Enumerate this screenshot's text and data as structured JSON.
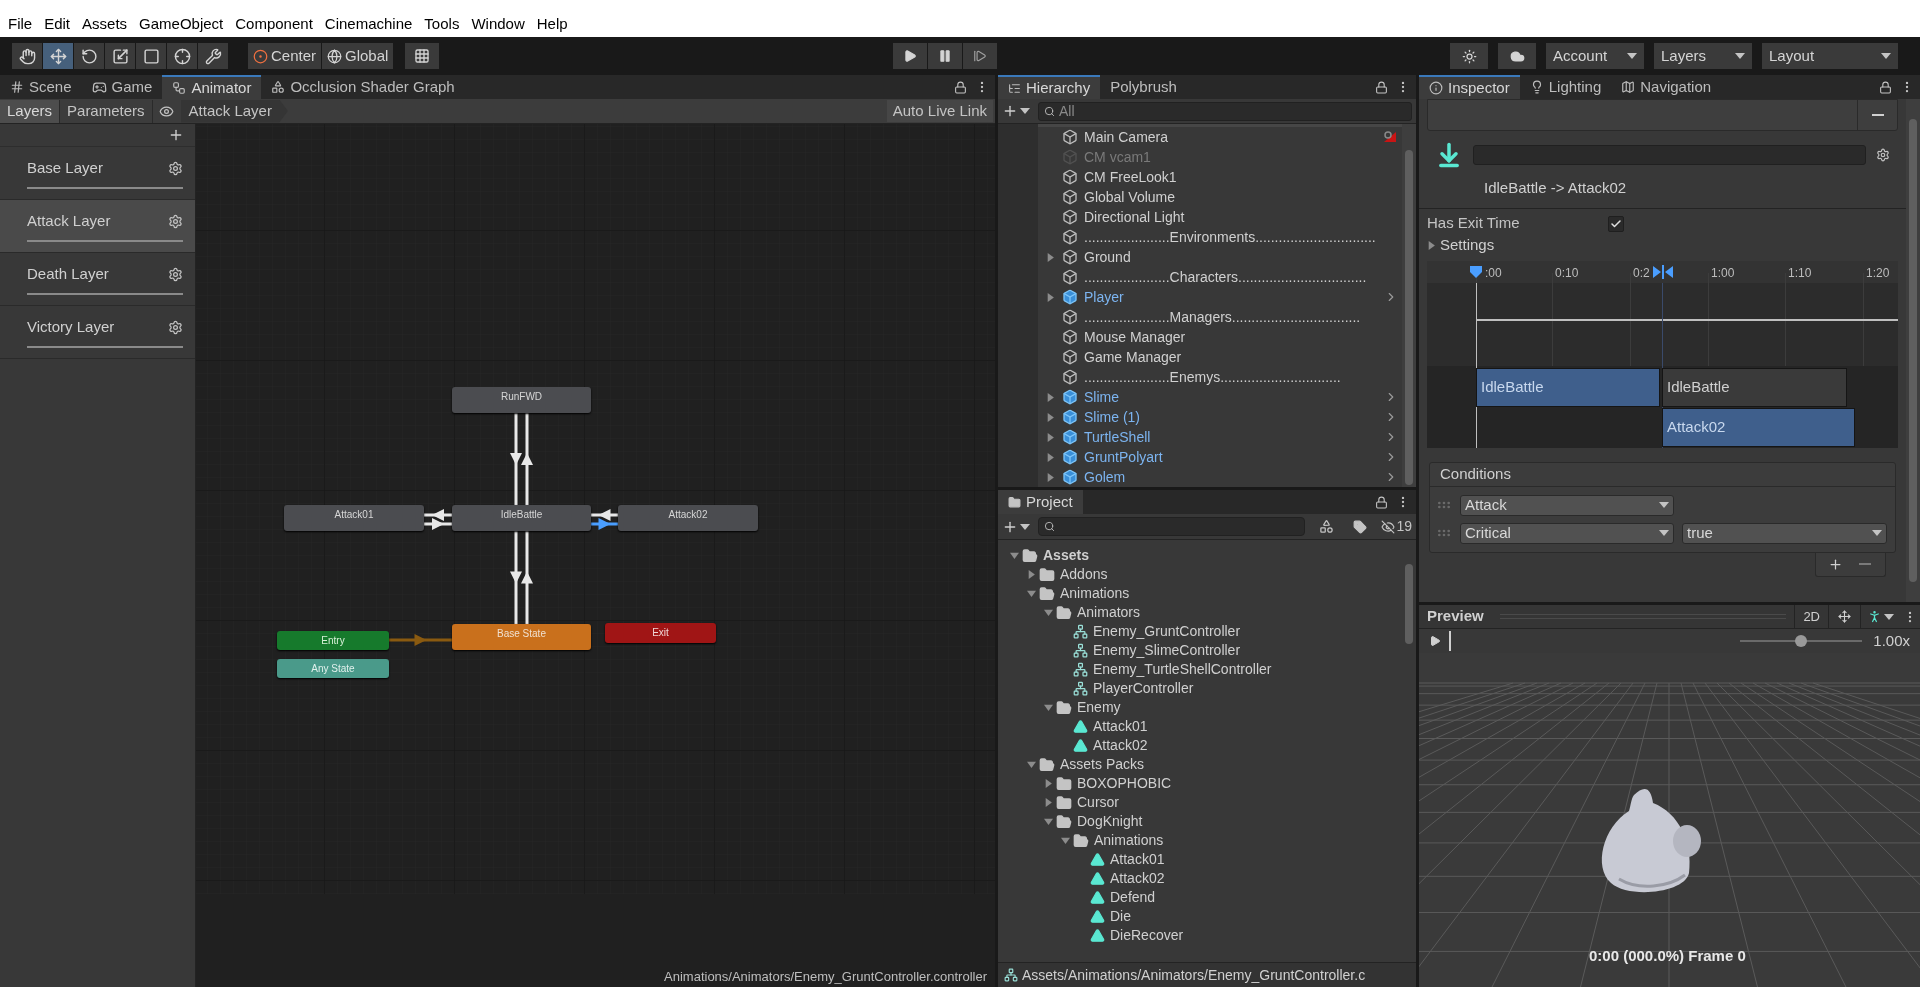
{
  "menu": [
    "File",
    "Edit",
    "Assets",
    "GameObject",
    "Component",
    "Cinemachine",
    "Tools",
    "Window",
    "Help"
  ],
  "toolbar": {
    "tools": [
      {
        "selected": false
      },
      {
        "selected": true
      },
      {
        "selected": false
      },
      {
        "selected": false
      },
      {
        "selected": false
      },
      {
        "selected": false
      },
      {
        "selected": false
      }
    ],
    "pivot": "Center",
    "space": "Global",
    "dropdowns": [
      "Account",
      "Layers",
      "Layout"
    ]
  },
  "animator": {
    "tabs": [
      {
        "label": "Scene",
        "selected": false
      },
      {
        "label": "Game",
        "selected": false
      },
      {
        "label": "Animator",
        "selected": true
      },
      {
        "label": "Occlusion Shader Graph",
        "selected": false
      }
    ],
    "side_tabs": [
      {
        "label": "Layers",
        "selected": true
      },
      {
        "label": "Parameters",
        "selected": false
      }
    ],
    "breadcrumb": "Attack Layer",
    "live_link": "Auto Live Link",
    "layers": [
      {
        "name": "Base Layer",
        "selected": false
      },
      {
        "name": "Attack Layer",
        "selected": true
      },
      {
        "name": "Death Layer",
        "selected": false
      },
      {
        "name": "Victory Layer",
        "selected": false
      }
    ],
    "nodes": [
      {
        "label": "RunFWD",
        "kind": "state"
      },
      {
        "label": "Attack01",
        "kind": "state"
      },
      {
        "label": "IdleBattle",
        "kind": "state"
      },
      {
        "label": "Attack02",
        "kind": "state"
      },
      {
        "label": "Base State",
        "kind": "default"
      },
      {
        "label": "Entry",
        "kind": "entry"
      },
      {
        "label": "Any State",
        "kind": "any"
      },
      {
        "label": "Exit",
        "kind": "exit"
      }
    ],
    "transitions": [
      {
        "kind": "normal",
        "selected": false
      },
      {
        "kind": "normal",
        "selected": false
      },
      {
        "kind": "normal",
        "selected": false
      },
      {
        "kind": "normal",
        "selected": false
      },
      {
        "kind": "normal",
        "selected": false
      },
      {
        "kind": "normal",
        "selected": true
      },
      {
        "kind": "normal",
        "selected": false
      },
      {
        "kind": "normal",
        "selected": false
      },
      {
        "kind": "entry",
        "selected": false
      }
    ],
    "path": "Animations/Animators/Enemy_GruntController.controller"
  },
  "hierarchy": {
    "tabs": [
      {
        "label": "Hierarchy",
        "selected": true
      },
      {
        "label": "Polybrush",
        "selected": false
      }
    ],
    "search": {
      "placeholder": "All"
    },
    "items": [
      {
        "name": "Main Camera",
        "kind": "object",
        "foldout": false,
        "disabled": false,
        "gizmo": true
      },
      {
        "name": "CM vcam1",
        "kind": "object",
        "foldout": false,
        "disabled": true,
        "gizmo": false
      },
      {
        "name": "CM FreeLook1",
        "kind": "object",
        "foldout": false,
        "disabled": false,
        "gizmo": false
      },
      {
        "name": "Global Volume",
        "kind": "object",
        "foldout": false,
        "disabled": false,
        "gizmo": false
      },
      {
        "name": "Directional Light",
        "kind": "object",
        "foldout": false,
        "disabled": false,
        "gizmo": false
      },
      {
        "name": "......................Environments...............................",
        "kind": "object",
        "foldout": false,
        "disabled": false,
        "gizmo": false
      },
      {
        "name": "Ground",
        "kind": "object",
        "foldout": true,
        "disabled": false,
        "gizmo": false
      },
      {
        "name": "......................Characters.................................",
        "kind": "object",
        "foldout": false,
        "disabled": false,
        "gizmo": false
      },
      {
        "name": "Player",
        "kind": "prefab",
        "foldout": true,
        "disabled": false,
        "gizmo": false
      },
      {
        "name": "......................Managers.................................",
        "kind": "object",
        "foldout": false,
        "disabled": false,
        "gizmo": false
      },
      {
        "name": "Mouse Manager",
        "kind": "object",
        "foldout": false,
        "disabled": false,
        "gizmo": false
      },
      {
        "name": "Game Manager",
        "kind": "object",
        "foldout": false,
        "disabled": false,
        "gizmo": false
      },
      {
        "name": "......................Enemys...............................",
        "kind": "object",
        "foldout": false,
        "disabled": false,
        "gizmo": false
      },
      {
        "name": "Slime",
        "kind": "prefab",
        "foldout": true,
        "disabled": false,
        "gizmo": false
      },
      {
        "name": "Slime (1)",
        "kind": "prefab",
        "foldout": true,
        "disabled": false,
        "gizmo": false
      },
      {
        "name": "TurtleShell",
        "kind": "prefab",
        "foldout": true,
        "disabled": false,
        "gizmo": false
      },
      {
        "name": "GruntPolyart",
        "kind": "prefab",
        "foldout": true,
        "disabled": false,
        "gizmo": false
      },
      {
        "name": "Golem",
        "kind": "prefab",
        "foldout": true,
        "disabled": false,
        "gizmo": false
      }
    ]
  },
  "project": {
    "tab": "Project",
    "hidden_count": "19",
    "tree": [
      {
        "name": "Assets",
        "kind": "folder",
        "expanded": true,
        "children": [
          {
            "name": "Addons",
            "kind": "folder",
            "expanded": false
          },
          {
            "name": "Animations",
            "kind": "folder",
            "expanded": true,
            "children": [
              {
                "name": "Animators",
                "kind": "folder",
                "expanded": true,
                "children": [
                  {
                    "name": "Enemy_GruntController",
                    "kind": "controller"
                  },
                  {
                    "name": "Enemy_SlimeController",
                    "kind": "controller"
                  },
                  {
                    "name": "Enemy_TurtleShellController",
                    "kind": "controller"
                  },
                  {
                    "name": "PlayerController",
                    "kind": "controller"
                  }
                ]
              },
              {
                "name": "Enemy",
                "kind": "folder",
                "expanded": true,
                "children": [
                  {
                    "name": "Attack01",
                    "kind": "clip"
                  },
                  {
                    "name": "Attack02",
                    "kind": "clip"
                  }
                ]
              }
            ]
          },
          {
            "name": "Assets Packs",
            "kind": "folder",
            "expanded": true,
            "children": [
              {
                "name": "BOXOPHOBIC",
                "kind": "folder",
                "expanded": false
              },
              {
                "name": "Cursor",
                "kind": "folder",
                "expanded": false
              },
              {
                "name": "DogKnight",
                "kind": "folder",
                "expanded": true,
                "children": [
                  {
                    "name": "Animations",
                    "kind": "folder",
                    "expanded": true,
                    "children": [
                      {
                        "name": "Attack01",
                        "kind": "clip"
                      },
                      {
                        "name": "Attack02",
                        "kind": "clip"
                      },
                      {
                        "name": "Defend",
                        "kind": "clip"
                      },
                      {
                        "name": "Die",
                        "kind": "clip"
                      },
                      {
                        "name": "DieRecover",
                        "kind": "clip"
                      }
                    ]
                  }
                ]
              }
            ]
          }
        ]
      }
    ],
    "status_path": "Assets/Animations/Animators/Enemy_GruntController.c"
  },
  "inspector": {
    "tabs": [
      {
        "label": "Inspector",
        "selected": true
      },
      {
        "label": "Lighting",
        "selected": false
      },
      {
        "label": "Navigation",
        "selected": false
      }
    ],
    "transition_name": "IdleBattle -> Attack02",
    "has_exit_time": {
      "label": "Has Exit Time",
      "checked": true
    },
    "settings": {
      "label": "Settings",
      "expanded": false
    },
    "timeline": {
      "ticks": [
        ":00",
        "0:10",
        "0:2",
        "1:00",
        "1:10",
        "1:20"
      ],
      "clips": [
        {
          "label": "IdleBattle",
          "selected": true
        },
        {
          "label": "IdleBattle",
          "selected": false
        },
        {
          "label": "Attack02",
          "selected": true
        }
      ]
    },
    "conditions": {
      "title": "Conditions",
      "rows": [
        {
          "parameter": "Attack"
        },
        {
          "parameter": "Critical",
          "value": "true"
        }
      ]
    }
  },
  "preview": {
    "title": "Preview",
    "mode": "2D",
    "speed": {
      "level": 0.5,
      "reading": "1.00x"
    },
    "status": "0:00 (000.0%) Frame 0"
  }
}
